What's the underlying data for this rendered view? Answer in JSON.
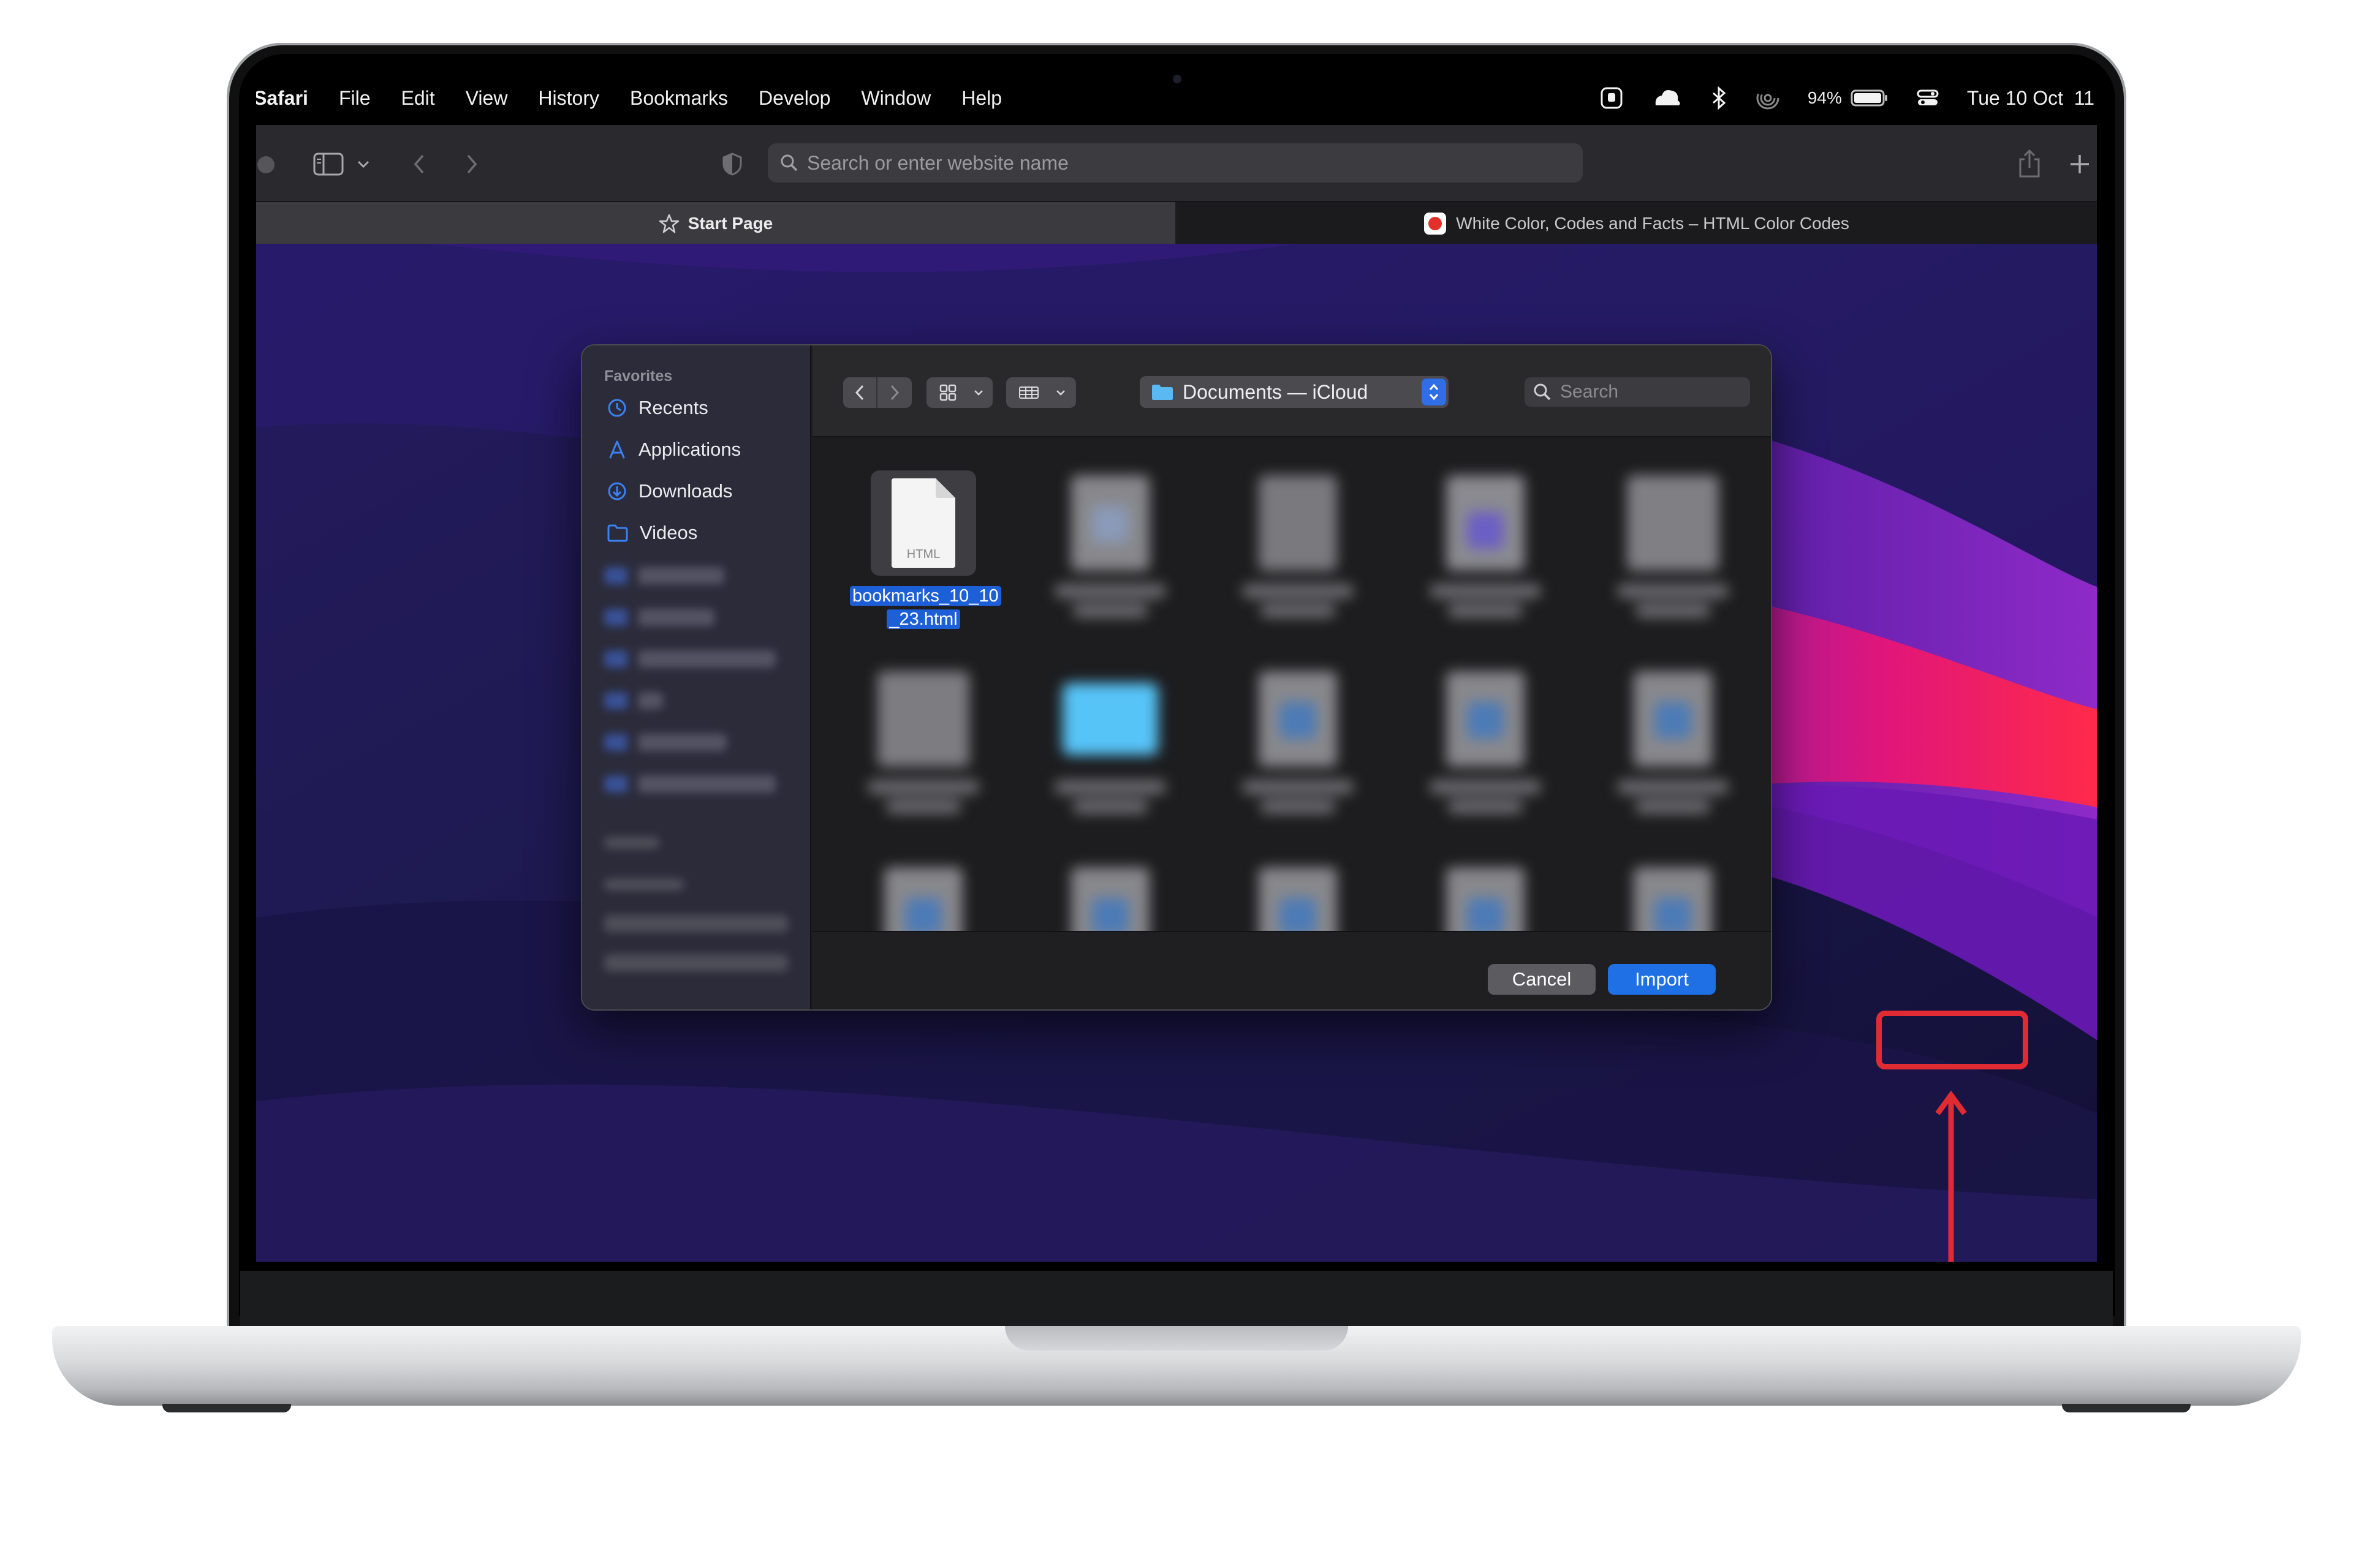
{
  "menubar": {
    "app_name": "Safari",
    "menus": [
      "File",
      "Edit",
      "View",
      "History",
      "Bookmarks",
      "Develop",
      "Window",
      "Help"
    ],
    "battery_percent": "94%",
    "datetime": "Tue 10 Oct  11"
  },
  "toolbar": {
    "address_placeholder": "Search or enter website name"
  },
  "tabs": [
    {
      "label": "Start Page",
      "active": true
    },
    {
      "label": "White Color, Codes and Facts – HTML Color Codes",
      "active": false
    }
  ],
  "dialog": {
    "sidebar": {
      "section_title": "Favorites",
      "items": [
        {
          "label": "Recents",
          "icon": "clock-icon"
        },
        {
          "label": "Applications",
          "icon": "applications-icon"
        },
        {
          "label": "Downloads",
          "icon": "download-icon"
        },
        {
          "label": "Videos",
          "icon": "folder-icon"
        }
      ]
    },
    "location": "Documents — iCloud",
    "search_placeholder": "Search",
    "selected_file": {
      "name_line1": "bookmarks_10_10",
      "name_line2": "_23.html",
      "type_label": "HTML"
    },
    "cancel_label": "Cancel",
    "import_label": "Import"
  },
  "colors": {
    "accent": "#1f6fe5",
    "highlight": "#e12b33",
    "folder": "#57c4f8"
  }
}
